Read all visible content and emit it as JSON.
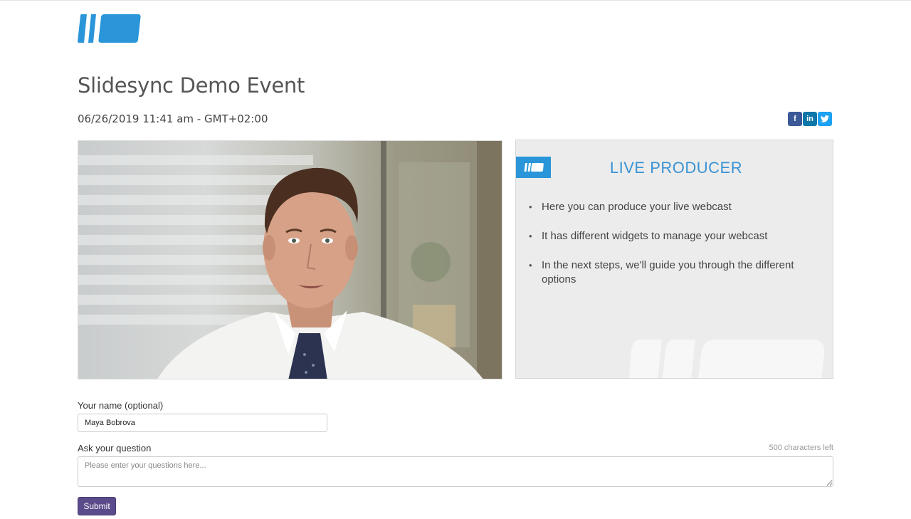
{
  "header": {
    "logo_icon": "slidesync-logo-icon",
    "brand_color": "#2a96d9"
  },
  "event": {
    "title": "Slidesync Demo Event",
    "datetime": "06/26/2019 11:41 am - GMT+02:00"
  },
  "social": [
    {
      "name": "facebook-icon",
      "glyph": "f",
      "color": "#3b5998"
    },
    {
      "name": "linkedin-icon",
      "glyph": "in",
      "color": "#0e76a8"
    },
    {
      "name": "twitter-icon",
      "glyph": "t",
      "color": "#1da1f2"
    }
  ],
  "slide": {
    "title": "LIVE PRODUCER",
    "bullets": [
      "Here you can produce your live webcast",
      "It has different widgets to manage your webcast",
      "In the next steps, we'll guide you through the different options"
    ],
    "accent_color": "#3a93d3"
  },
  "form": {
    "name_label": "Your name (optional)",
    "name_value": "Maya Bobrova",
    "question_label": "Ask your question",
    "chars_left": "500 characters left",
    "question_placeholder": "Please enter your questions here...",
    "submit_label": "Submit",
    "submit_color": "#5b4b8a"
  }
}
